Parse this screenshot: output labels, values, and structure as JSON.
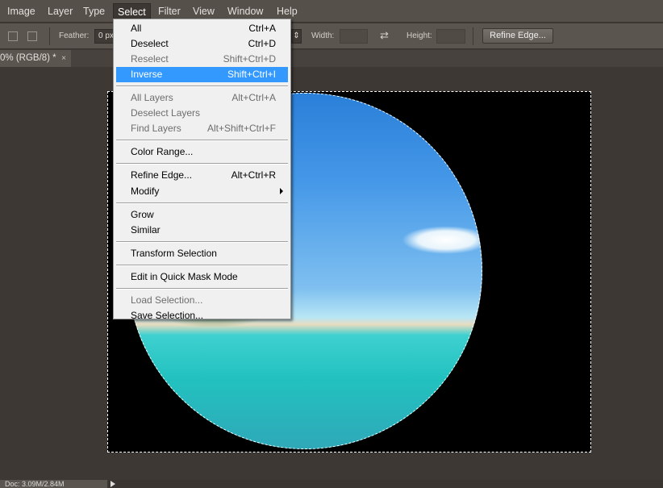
{
  "menubar": {
    "items": [
      "Image",
      "Layer",
      "Type",
      "Select",
      "Filter",
      "View",
      "Window",
      "Help"
    ],
    "active": "Select"
  },
  "options": {
    "feather_label": "Feather:",
    "feather_value": "0 px",
    "width_label": "Width:",
    "height_label": "Height:",
    "refine_edge": "Refine Edge..."
  },
  "document_tab": {
    "title": "0% (RGB/8) *",
    "close": "×"
  },
  "status": {
    "doc": "Doc: 3.09M/2.84M"
  },
  "select_menu": {
    "groups": [
      [
        {
          "label": "All",
          "shortcut": "Ctrl+A",
          "enabled": true
        },
        {
          "label": "Deselect",
          "shortcut": "Ctrl+D",
          "enabled": true
        },
        {
          "label": "Reselect",
          "shortcut": "Shift+Ctrl+D",
          "enabled": false
        },
        {
          "label": "Inverse",
          "shortcut": "Shift+Ctrl+I",
          "enabled": true,
          "highlighted": true
        }
      ],
      [
        {
          "label": "All Layers",
          "shortcut": "Alt+Ctrl+A",
          "enabled": false
        },
        {
          "label": "Deselect Layers",
          "shortcut": "",
          "enabled": false
        },
        {
          "label": "Find Layers",
          "shortcut": "Alt+Shift+Ctrl+F",
          "enabled": false
        }
      ],
      [
        {
          "label": "Color Range...",
          "shortcut": "",
          "enabled": true
        }
      ],
      [
        {
          "label": "Refine Edge...",
          "shortcut": "Alt+Ctrl+R",
          "enabled": true
        },
        {
          "label": "Modify",
          "shortcut": "",
          "enabled": true,
          "submenu": true
        }
      ],
      [
        {
          "label": "Grow",
          "shortcut": "",
          "enabled": true
        },
        {
          "label": "Similar",
          "shortcut": "",
          "enabled": true
        }
      ],
      [
        {
          "label": "Transform Selection",
          "shortcut": "",
          "enabled": true
        }
      ],
      [
        {
          "label": "Edit in Quick Mask Mode",
          "shortcut": "",
          "enabled": true
        }
      ],
      [
        {
          "label": "Load Selection...",
          "shortcut": "",
          "enabled": false
        },
        {
          "label": "Save Selection...",
          "shortcut": "",
          "enabled": true
        }
      ]
    ]
  },
  "colors": {
    "highlight": "#3399ff",
    "workspace": "#3e3834"
  }
}
